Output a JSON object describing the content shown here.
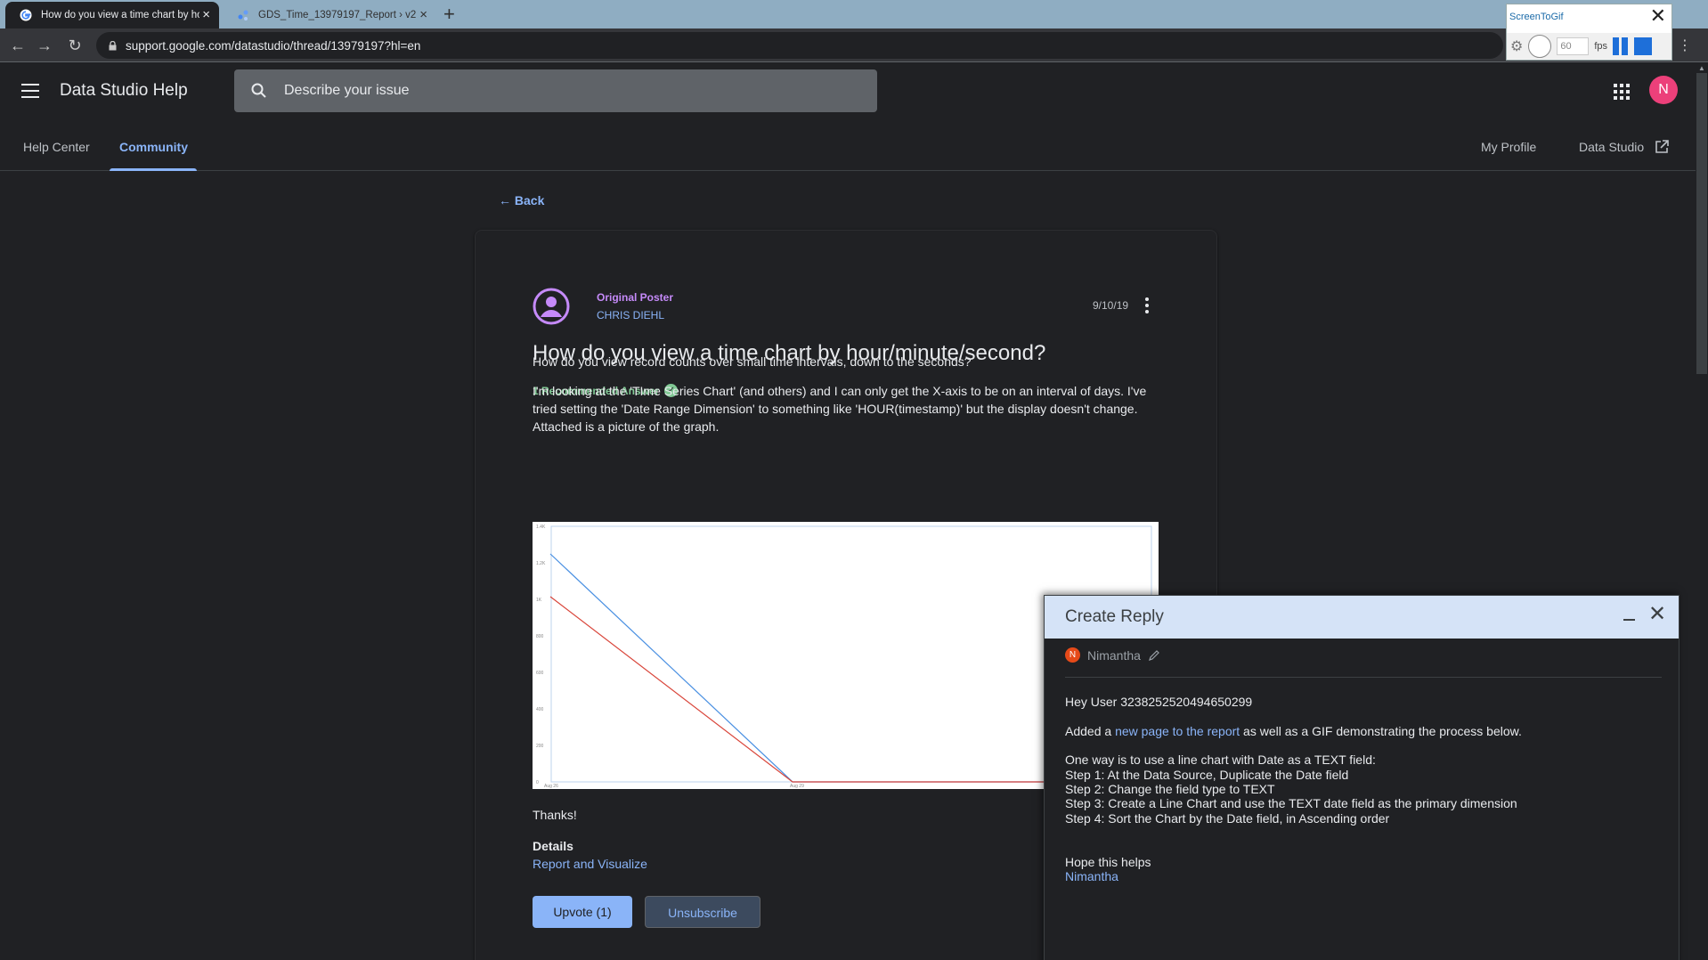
{
  "browser": {
    "tabs": [
      {
        "title": "How do you view a time chart by hour/minute/second? - Data Studio Community",
        "active": true,
        "favicon": "google-g-icon"
      },
      {
        "title": "GDS_Time_13979197_Report › v2",
        "active": false,
        "favicon": "data-studio-icon"
      }
    ],
    "url": "support.google.com/datastudio/thread/13979197?hl=en"
  },
  "screentogif": {
    "title": "ScreenToGif",
    "fps_value": "60",
    "fps_label": "fps"
  },
  "header": {
    "app_title": "Data Studio Help",
    "search_placeholder": "Describe your issue",
    "avatar_initial": "N"
  },
  "subnav": {
    "help_center": "Help Center",
    "community": "Community",
    "my_profile": "My Profile",
    "data_studio": "Data Studio"
  },
  "back_label": "Back",
  "post": {
    "role_label": "Original Poster",
    "author": "CHRIS DIEHL",
    "date": "9/10/19",
    "title": "How do you view a time chart by hour/minute/second?",
    "recommended": "1 Recommended Answer",
    "para1": "How do you view record counts over small time intervals, down to the seconds?",
    "para2": "I'm looking at the 'TIme Series Chart' (and others) and I can only get the X-axis to be on an interval of days. I've tried setting the 'Date Range Dimension' to something like 'HOUR(timestamp)' but the display doesn't change. Attached is a picture of the graph.",
    "thanks": "Thanks!",
    "details_heading": "Details",
    "details_link": "Report and Visualize",
    "upvote_label": "Upvote (1)",
    "unsubscribe_label": "Unsubscribe"
  },
  "attached_chart": {
    "y_ticks": [
      "1.4K",
      "1.2K",
      "1K",
      "800",
      "600",
      "400",
      "200",
      "0"
    ],
    "x_ticks": [
      "Aug 26",
      "Aug 29"
    ],
    "series_colors": {
      "blue": "#4a90e2",
      "red": "#d9463b"
    }
  },
  "reply": {
    "title": "Create Reply",
    "user_initial": "N",
    "user_name": "Nimantha",
    "greeting": "Hey User 3238252520494650299",
    "added_pre": "Added a ",
    "added_link": "new page to the report",
    "added_post": " as well as a GIF demonstrating the process below.",
    "steps_intro": "One way is to use a line chart with Date as a TEXT field:",
    "step1": "Step 1: At the Data Source, Duplicate the Date field",
    "step2": "Step 2: Change the field type to TEXT",
    "step3": "Step 3: Create a Line Chart and use the TEXT date field as the primary dimension",
    "step4": "Step 4: Sort the Chart by the Date field, in Ascending order",
    "closing": "Hope this helps",
    "signature": "Nimantha"
  }
}
